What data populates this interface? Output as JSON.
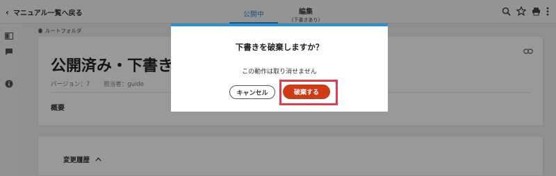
{
  "header": {
    "back_label": "マニュアル一覧へ戻る",
    "tabs": [
      {
        "label": "公開中",
        "active": true
      },
      {
        "label": "編集",
        "sublabel": "(下書きあり)",
        "active": false
      }
    ],
    "icons": [
      "search-icon",
      "star-icon",
      "print-icon",
      "more-icon"
    ]
  },
  "breadcrumb": {
    "icon": "home-icon",
    "label": "ルートフォルダ"
  },
  "page": {
    "title": "公開済み・下書きあ",
    "version": "バージョン：7",
    "owner": "担当者：guide",
    "summary_heading": "概要",
    "history_heading": "変更履歴"
  },
  "dialog": {
    "title": "下書きを破棄しますか？",
    "message": "この動作は取り消せません",
    "cancel_label": "キャンセル",
    "confirm_label": "破棄する"
  },
  "colors": {
    "accent": "#2b8fd0",
    "danger": "#d13a16",
    "highlight": "#e53a4a"
  }
}
